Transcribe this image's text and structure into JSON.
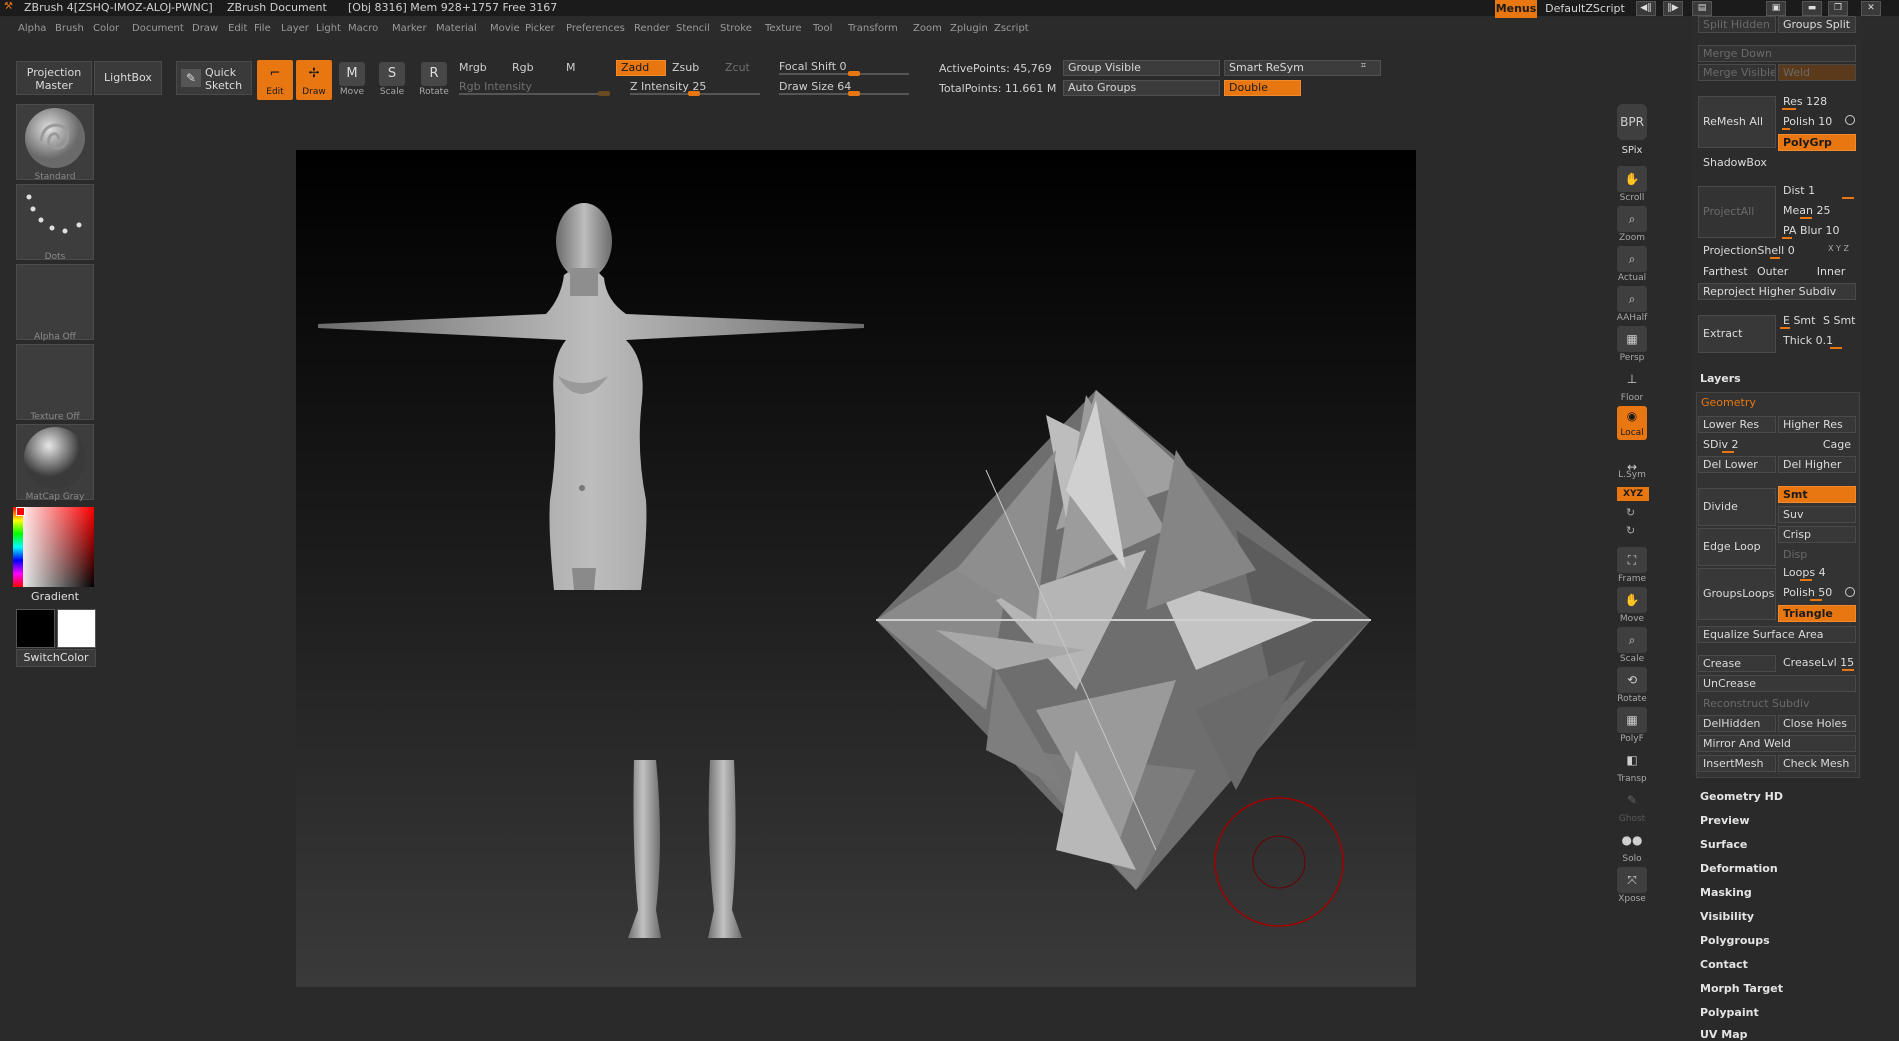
{
  "title_bar": {
    "app": "ZBrush 4[ZSHQ-IMOZ-ALOJ-PWNC]",
    "document": "ZBrush Document",
    "stats": "[Obj 8316] Mem 928+1757 Free 3167"
  },
  "menu_bar": {
    "items": [
      "Alpha",
      "Brush",
      "Color",
      "Document",
      "Draw",
      "Edit",
      "File",
      "Layer",
      "Light",
      "Macro",
      "Marker",
      "Material",
      "Movie",
      "Picker",
      "Preferences",
      "Render",
      "Stencil",
      "Stroke",
      "Texture",
      "Tool",
      "Transform",
      "Zoom",
      "Zplugin",
      "Zscript"
    ],
    "menus_label": "Menus",
    "script_label": "DefaultZScript"
  },
  "toolbar": {
    "projection_master": "Projection Master",
    "lightbox": "LightBox",
    "quick_sketch": "Quick Sketch",
    "edit": "Edit",
    "draw": "Draw",
    "move": "Move",
    "scale": "Scale",
    "rotate": "Rotate",
    "mrgb": "Mrgb",
    "rgb": "Rgb",
    "m": "M",
    "rgb_intensity": "Rgb Intensity",
    "zadd": "Zadd",
    "zsub": "Zsub",
    "zcut": "Zcut",
    "z_intensity": "Z Intensity 25",
    "focal_shift": "Focal Shift 0",
    "draw_size": "Draw Size 64",
    "active_points": "ActivePoints: 45,769",
    "total_points": "TotalPoints: 11.661 M",
    "group_visible": "Group Visible",
    "smart_resym": "Smart ReSym",
    "auto_groups": "Auto Groups",
    "double": "Double"
  },
  "left_shelf": {
    "brush": "Standard",
    "stroke": "Dots",
    "alpha": "Alpha Off",
    "texture": "Texture Off",
    "material": "MatCap Gray",
    "gradient": "Gradient",
    "switch_color": "SwitchColor"
  },
  "right_nav": {
    "bpr": "BPR",
    "spix": "SPix",
    "scroll": "Scroll",
    "zoom": "Zoom",
    "actual": "Actual",
    "aahalf": "AAHalf",
    "persp": "Persp",
    "floor": "Floor",
    "local": "Local",
    "lsym": "L.Sym",
    "xyz": "XYZ",
    "frame": "Frame",
    "move": "Move",
    "scale": "Scale",
    "rotate": "Rotate",
    "polyf": "PolyF",
    "transp": "Transp",
    "ghost": "Ghost",
    "solo": "Solo",
    "xpose": "Xpose"
  },
  "palette": {
    "split_hidden": "Split Hidden",
    "groups_split": "Groups Split",
    "merge_down": "Merge Down",
    "merge_visible": "Merge Visible",
    "weld": "Weld",
    "remesh_all": "ReMesh All",
    "res": "Res 128",
    "polish": "Polish 10",
    "polygrp": "PolyGrp",
    "shadowbox": "ShadowBox",
    "project_all": "ProjectAll",
    "dist": "Dist 1",
    "mean": "Mean 25",
    "pa_blur": "PA Blur 10",
    "projection_shell": "ProjectionShell 0",
    "xyz_mini": "X Y Z",
    "farthest": "Farthest",
    "outer": "Outer",
    "inner": "Inner",
    "reproject": "Reproject Higher Subdiv",
    "extract": "Extract",
    "e_smt": "E Smt",
    "s_smt": "S Smt",
    "thick": "Thick 0.1",
    "layers": "Layers",
    "geometry": "Geometry",
    "lower_res": "Lower Res",
    "higher_res": "Higher Res",
    "sdiv": "SDiv 2",
    "cage": "Cage",
    "del_lower": "Del Lower",
    "del_higher": "Del Higher",
    "divide": "Divide",
    "smt": "Smt",
    "suv": "Suv",
    "edge_loop": "Edge Loop",
    "crisp": "Crisp",
    "disp": "Disp",
    "groups_loops": "GroupsLoops",
    "loops": "Loops 4",
    "polish2": "Polish 50",
    "triangle": "Triangle",
    "equalize": "Equalize Surface Area",
    "crease": "Crease",
    "crease_lvl": "CreaseLvl 15",
    "uncrease": "UnCrease",
    "reconstruct": "Reconstruct Subdiv",
    "del_hidden": "DelHidden",
    "close_holes": "Close Holes",
    "mirror_weld": "Mirror And Weld",
    "insert_mesh": "InsertMesh",
    "check_mesh": "Check Mesh",
    "sections": [
      "Geometry HD",
      "Preview",
      "Surface",
      "Deformation",
      "Masking",
      "Visibility",
      "Polygroups",
      "Contact",
      "Morph Target",
      "Polypaint",
      "UV Map"
    ]
  },
  "colors": {
    "accent": "#e87711",
    "background": "#2a2a2a",
    "canvas_top": "#000000",
    "canvas_bottom": "#3a3a3a"
  }
}
